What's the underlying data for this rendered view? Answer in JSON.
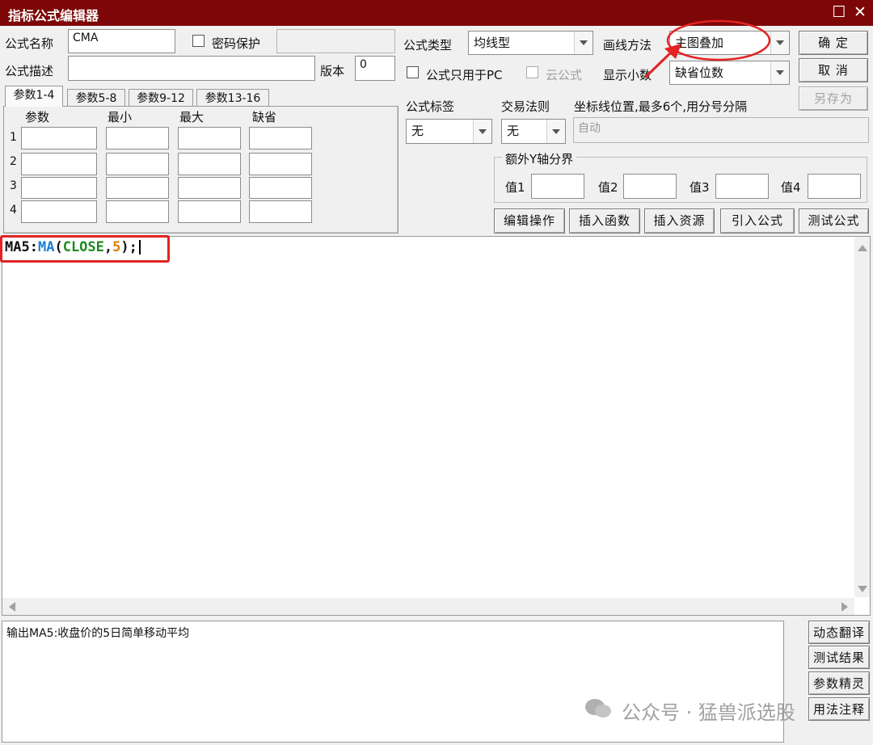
{
  "window": {
    "title": "指标公式编辑器"
  },
  "fields": {
    "name_label": "公式名称",
    "name_value": "CMA",
    "password_label": "密码保护",
    "desc_label": "公式描述",
    "desc_value": "",
    "version_label": "版本",
    "version_value": "0",
    "type_label": "公式类型",
    "type_value": "均线型",
    "draw_label": "画线方法",
    "draw_value": "主图叠加",
    "pc_only_label": "公式只用于PC",
    "cloud_label": "云公式",
    "decimals_label": "显示小数",
    "decimals_value": "缺省位数",
    "tag_label": "公式标签",
    "tag_value": "无",
    "trade_label": "交易法则",
    "trade_value": "无",
    "axis_label": "坐标线位置,最多6个,用分号分隔",
    "axis_value": "自动",
    "ybound_label": "额外Y轴分界",
    "ybound_values": [
      "值1",
      "值2",
      "值3",
      "值4"
    ]
  },
  "buttons": {
    "ok": "确  定",
    "cancel": "取  消",
    "save_as": "另存为",
    "edit_ops": "编辑操作",
    "insert_func": "插入函数",
    "insert_res": "插入资源",
    "import_formula": "引入公式",
    "test_formula": "测试公式",
    "dyn_translate": "动态翻译",
    "test_result": "测试结果",
    "param_wizard": "参数精灵",
    "usage_note": "用法注释"
  },
  "param_tabs": [
    "参数1-4",
    "参数5-8",
    "参数9-12",
    "参数13-16"
  ],
  "param_headers": [
    "参数",
    "最小",
    "最大",
    "缺省"
  ],
  "param_rows": [
    "1",
    "2",
    "3",
    "4"
  ],
  "code": {
    "var": "MA5",
    "colon": ":",
    "func": "MA",
    "open": "(",
    "arg1": "CLOSE",
    "comma": ",",
    "arg2": "5",
    "close": ");"
  },
  "output_text": "输出MA5:收盘价的5日简单移动平均",
  "watermark": "公众号 · 猛兽派选股",
  "colors": {
    "titlebar": "#7d0707",
    "func": "#1a7fd4",
    "arg": "#1c8a1c",
    "num": "#e07b00",
    "highlight": "#e32222"
  }
}
